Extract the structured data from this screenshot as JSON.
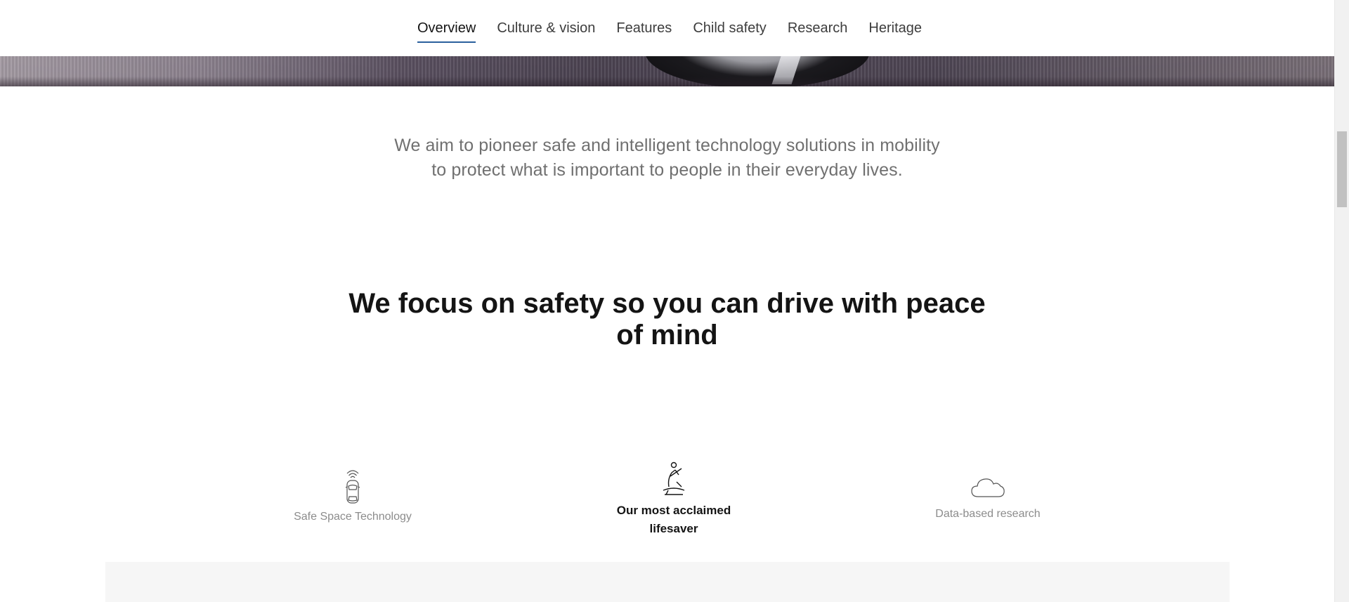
{
  "subnav": {
    "items": [
      {
        "label": "Overview",
        "active": true
      },
      {
        "label": "Culture & vision"
      },
      {
        "label": "Features"
      },
      {
        "label": "Child safety"
      },
      {
        "label": "Research"
      },
      {
        "label": "Heritage"
      }
    ]
  },
  "intro": {
    "line1": "We aim to pioneer safe and intelligent technology solutions in mobility",
    "line2": "to protect what is important to people in their everyday lives."
  },
  "heading": {
    "line1": "We focus on safety so you can drive with peace",
    "line2": "of mind"
  },
  "features": [
    {
      "label": "Safe Space Technology",
      "icon": "car-signal-icon",
      "active": false
    },
    {
      "label_line1": "Our most acclaimed",
      "label_line2": "lifesaver",
      "icon": "seatbelt-icon",
      "active": true
    },
    {
      "label": "Data-based research",
      "icon": "cloud-icon",
      "active": false
    }
  ],
  "colors": {
    "accent": "#2a609d",
    "text": "#141414",
    "muted": "#707070",
    "inactive_label": "#8c8c8c",
    "panel": "#f6f6f6"
  }
}
